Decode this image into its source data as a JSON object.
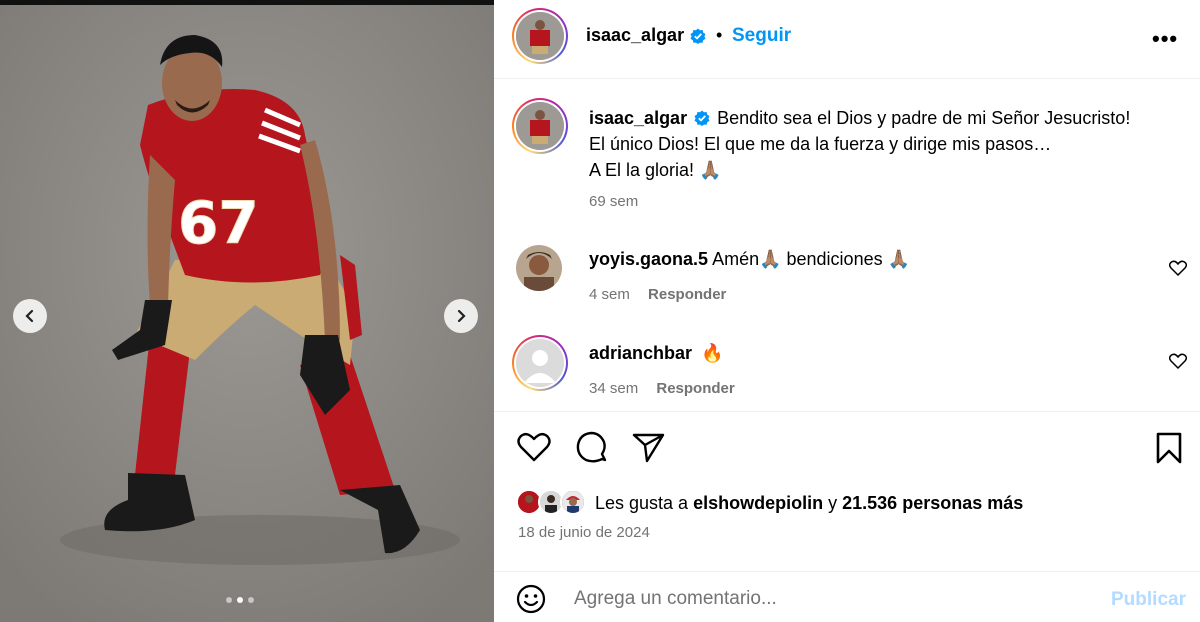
{
  "post": {
    "username": "isaac_algar",
    "follow_label": "Seguir",
    "separator": "•",
    "more_label": "•••",
    "caption_lines": [
      "Bendito sea el Dios y padre de mi Señor Jesucristo!",
      "El único Dios! El que me da la fuerza y dirige mis pasos…",
      "A El la gloria! 🙏🏽"
    ],
    "caption_age": "69 sem",
    "media": {
      "slide_count": 3,
      "active_slide": 2,
      "jersey_number": "67",
      "team_mark": "49ers"
    }
  },
  "comments": [
    {
      "username": "yoyis.gaona.5",
      "text": "Amén🙏🏽 bendiciones 🙏🏽",
      "age": "4 sem",
      "reply_label": "Responder"
    },
    {
      "username": "adrianchbar",
      "text": "🔥",
      "age": "34 sem",
      "reply_label": "Responder"
    }
  ],
  "likes": {
    "prefix": "Les gusta a",
    "user": "elshowdepiolin",
    "connector": "y",
    "count_text": "21.536 personas más"
  },
  "date": "18 de junio de 2024",
  "comment_box": {
    "placeholder": "Agrega un comentario...",
    "publish_label": "Publicar"
  },
  "colors": {
    "link_blue": "#0095f6",
    "publish_disabled": "#b3dbff",
    "muted": "#737373",
    "niners_red": "#b5151d",
    "niners_gold": "#c9ab73"
  }
}
